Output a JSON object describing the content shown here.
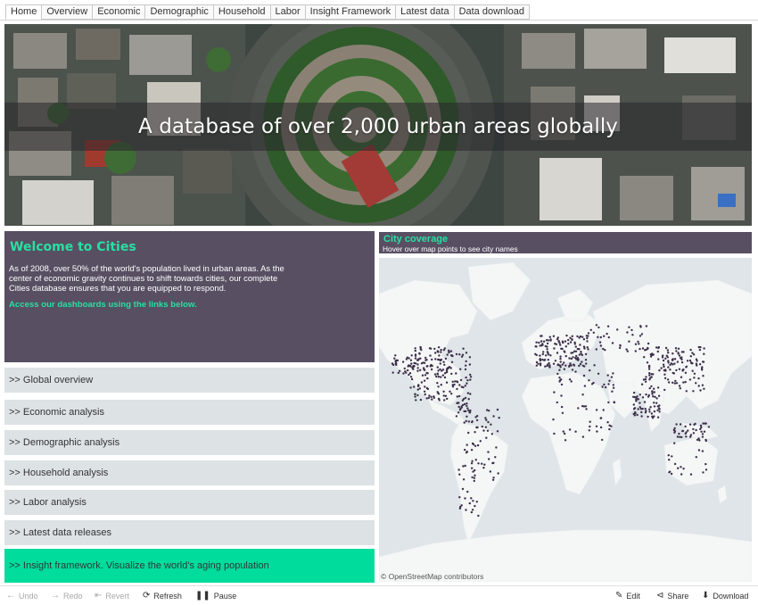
{
  "tabs": [
    "Home",
    "Overview",
    "Economic",
    "Demographic",
    "Household",
    "Labor",
    "Insight Framework",
    "Latest data",
    "Data download"
  ],
  "banner": {
    "title": "A database of over 2,000 urban areas globally"
  },
  "welcome": {
    "title": "Welcome to Cities",
    "body": "As of 2008, over 50% of the world's population lived in urban areas. As the center of economic gravity continues to shift towards cities, our complete Cities database ensures that you are equipped to respond.",
    "access": "Access our dashboards using the links below."
  },
  "nav": {
    "global": ">> Global overview",
    "economic": ">> Economic analysis",
    "demographic": ">> Demographic analysis",
    "household": ">> Household analysis",
    "labor": ">> Labor analysis",
    "latest": ">> Latest data releases",
    "insight": ">> Insight framework. Visualize the world's aging population"
  },
  "coverage": {
    "title": "City coverage",
    "subtitle": "Hover over map points to see city names",
    "attribution": "© OpenStreetMap contributors"
  },
  "toolbar": {
    "undo": "Undo",
    "redo": "Redo",
    "revert": "Revert",
    "refresh": "Refresh",
    "pause": "Pause",
    "edit": "Edit",
    "share": "Share",
    "download": "Download"
  },
  "colors": {
    "accent": "#00dc9c",
    "panel": "#584f63",
    "nav_bg": "#dde2e5",
    "map_water": "#dfe5e8",
    "map_land": "#f5f6f6",
    "dot": "#3c2f4a"
  }
}
